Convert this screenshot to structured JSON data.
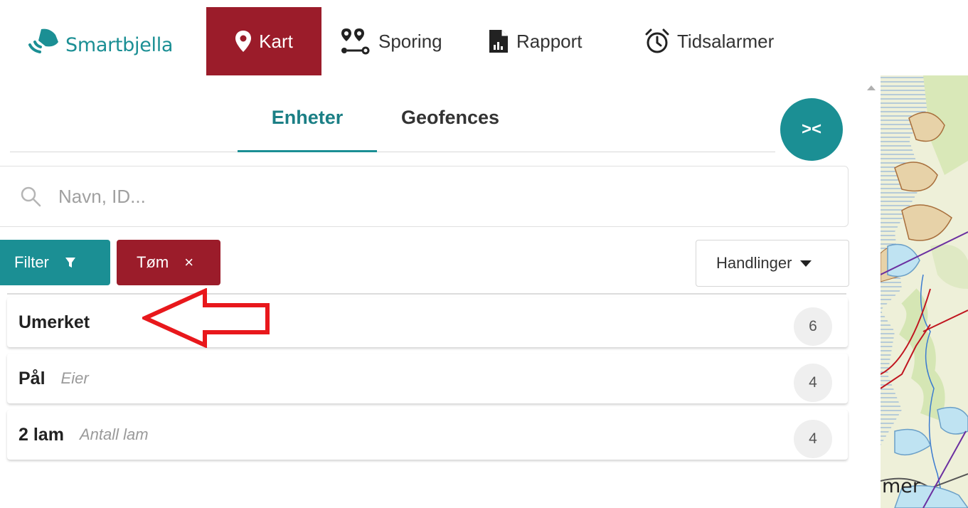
{
  "brand": {
    "name": "Smartbjella",
    "color": "#1b8f94"
  },
  "nav": {
    "kart": "Kart",
    "sporing": "Sporing",
    "rapport": "Rapport",
    "tidsalarmer": "Tidsalarmer"
  },
  "tabs": {
    "enheter": "Enheter",
    "geofences": "Geofences",
    "collapse_icon": "><"
  },
  "search": {
    "placeholder": "Navn, ID..."
  },
  "toolbar": {
    "filter_label": "Filter",
    "clear_label": "Tøm",
    "clear_icon": "×",
    "actions_label": "Handlinger"
  },
  "groups": [
    {
      "name": "Umerket",
      "tag": "",
      "count": "6"
    },
    {
      "name": "Pål",
      "tag": "Eier",
      "count": "4"
    },
    {
      "name": "2 lam",
      "tag": "Antall lam",
      "count": "4"
    }
  ],
  "map": {
    "label": "mer"
  },
  "colors": {
    "accent": "#1b8f94",
    "danger": "#9b1c2a",
    "arrow": "#e8181c"
  }
}
